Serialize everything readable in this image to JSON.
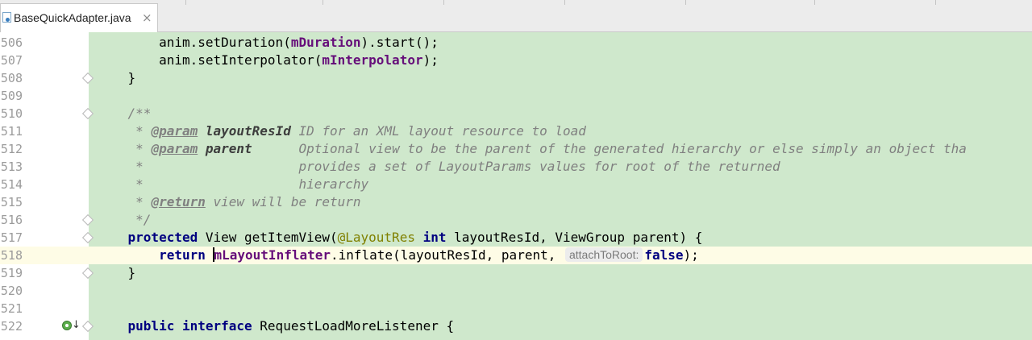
{
  "editor": {
    "tab": {
      "label": "BaseQuickAdapter.java",
      "close": "×"
    },
    "lines": [
      {
        "num": "506",
        "tokens": [
          [
            "",
            "        anim.setDuration("
          ],
          [
            "fld",
            "mDuration"
          ],
          [
            "",
            ").start();"
          ]
        ]
      },
      {
        "num": "507",
        "tokens": [
          [
            "",
            "        anim.setInterpolator("
          ],
          [
            "fld",
            "mInterpolator"
          ],
          [
            "",
            ");"
          ]
        ]
      },
      {
        "num": "508",
        "fold": true,
        "tokens": [
          [
            "",
            "    }"
          ]
        ]
      },
      {
        "num": "509",
        "tokens": []
      },
      {
        "num": "510",
        "fold": true,
        "tokens": [
          [
            "doc",
            "    /**"
          ]
        ]
      },
      {
        "num": "511",
        "tokens": [
          [
            "doc",
            "     * "
          ],
          [
            "doctag",
            "@param"
          ],
          [
            "doc",
            " "
          ],
          [
            "docparam",
            "layoutResId"
          ],
          [
            "doc",
            " ID for an XML layout resource to load"
          ]
        ]
      },
      {
        "num": "512",
        "tokens": [
          [
            "doc",
            "     * "
          ],
          [
            "doctag",
            "@param"
          ],
          [
            "doc",
            " "
          ],
          [
            "docparam",
            "parent"
          ],
          [
            "doc",
            "      Optional view to be the parent of the generated hierarchy or else simply an object tha"
          ]
        ]
      },
      {
        "num": "513",
        "tokens": [
          [
            "doc",
            "     *                    provides a set of LayoutParams values for root of the returned"
          ]
        ]
      },
      {
        "num": "514",
        "tokens": [
          [
            "doc",
            "     *                    hierarchy"
          ]
        ]
      },
      {
        "num": "515",
        "tokens": [
          [
            "doc",
            "     * "
          ],
          [
            "doctag",
            "@return"
          ],
          [
            "doc",
            " view will be return"
          ]
        ]
      },
      {
        "num": "516",
        "fold": true,
        "tokens": [
          [
            "doc",
            "     */"
          ]
        ]
      },
      {
        "num": "517",
        "fold": true,
        "tokens": [
          [
            "kw",
            "    protected"
          ],
          [
            "",
            " View getItemView("
          ],
          [
            "annot",
            "@LayoutRes"
          ],
          [
            "",
            " "
          ],
          [
            "kw",
            "int"
          ],
          [
            "",
            " layoutResId, ViewGroup parent) {"
          ]
        ]
      },
      {
        "num": "518",
        "current": true,
        "tokens": [
          [
            "kw",
            "        return"
          ],
          [
            "",
            " "
          ],
          [
            "caret",
            ""
          ],
          [
            "fld",
            "mLayoutInflater"
          ],
          [
            "",
            ".inflate(layoutResId, parent, "
          ],
          [
            "hint",
            "attachToRoot:"
          ],
          [
            "kw",
            "false"
          ],
          [
            "",
            ");"
          ]
        ]
      },
      {
        "num": "519",
        "fold": true,
        "tokens": [
          [
            "",
            "    }"
          ]
        ]
      },
      {
        "num": "520",
        "tokens": []
      },
      {
        "num": "521",
        "tokens": []
      },
      {
        "num": "522",
        "fold": true,
        "implemented": true,
        "tokens": [
          [
            "kw",
            "    public interface"
          ],
          [
            "",
            " RequestLoadMoreListener {"
          ]
        ]
      }
    ]
  }
}
